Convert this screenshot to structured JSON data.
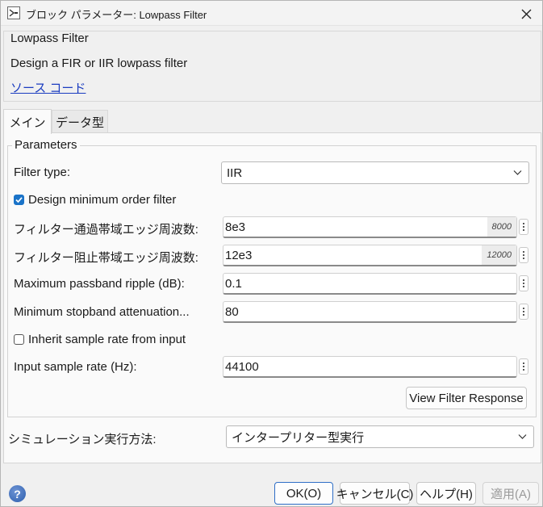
{
  "window": {
    "title": "ブロック パラメーター: Lowpass Filter",
    "close_glyph": "✕"
  },
  "description": {
    "block_name": "Lowpass Filter",
    "text": "Design a FIR or IIR lowpass filter",
    "source_link": "ソース コード"
  },
  "tabs": [
    {
      "label": "メイン",
      "active": true
    },
    {
      "label": "データ型",
      "active": false
    }
  ],
  "parameters": {
    "group_label": "Parameters",
    "filter_type": {
      "label": "Filter type:",
      "value": "IIR"
    },
    "design_min_order": {
      "label": "Design minimum order filter",
      "checked": true
    },
    "passband_edge": {
      "label": "フィルター通過帯域エッジ周波数:",
      "value": "8e3",
      "evaluated": "8000"
    },
    "stopband_edge": {
      "label": "フィルター阻止帯域エッジ周波数:",
      "value": "12e3",
      "evaluated": "12000"
    },
    "passband_ripple": {
      "label": "Maximum passband ripple (dB):",
      "value": "0.1"
    },
    "stopband_atten": {
      "label": "Minimum stopband attenuation...",
      "value": "80"
    },
    "inherit_sample_rate": {
      "label": "Inherit sample rate from input",
      "checked": false
    },
    "input_sample_rate": {
      "label": "Input sample rate (Hz):",
      "value": "44100"
    },
    "view_response_button": "View Filter Response"
  },
  "simulation": {
    "label": "シミュレーション実行方法:",
    "value": "インタープリター型実行"
  },
  "footer": {
    "help_glyph": "?",
    "ok": "OK(O)",
    "cancel": "キャンセル(C)",
    "help": "ヘルプ(H)",
    "apply": "適用(A)"
  },
  "colors": {
    "accent": "#1a73c8",
    "link": "#1a3cc0"
  }
}
